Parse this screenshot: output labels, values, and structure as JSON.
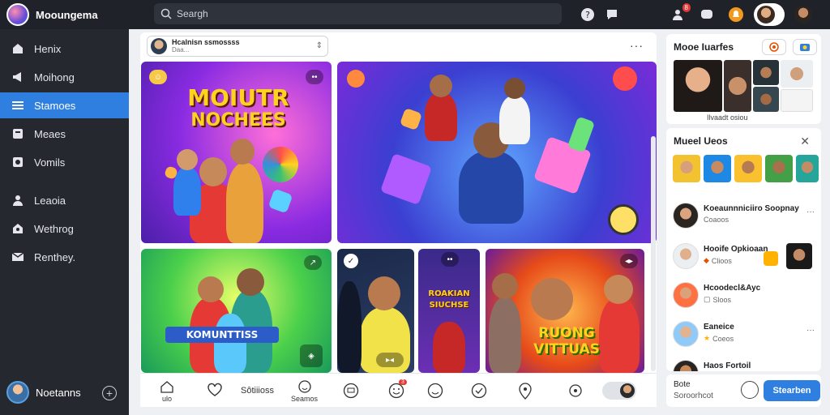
{
  "app": {
    "title": "Mooungema"
  },
  "search": {
    "placeholder": "Seargh"
  },
  "topbar": {
    "notification_count": "8"
  },
  "sidebar": {
    "items": [
      {
        "label": "Henix",
        "icon": "home-icon"
      },
      {
        "label": "Moihong",
        "icon": "megaphone-icon"
      },
      {
        "label": "Stamoes",
        "icon": "list-icon"
      },
      {
        "label": "Meaes",
        "icon": "message-icon"
      },
      {
        "label": "Vomils",
        "icon": "video-icon"
      },
      {
        "label": "Leaoia",
        "icon": "person-icon"
      },
      {
        "label": "Wethrog",
        "icon": "globe-icon"
      },
      {
        "label": "Renthey.",
        "icon": "mail-icon"
      }
    ],
    "profile_name": "Noetanns"
  },
  "composer": {
    "line1": "Hcalnisn ssmossss",
    "line2": "Daa..."
  },
  "tiles": {
    "tile1_title_a": "MOIUTR",
    "tile1_title_b": "NOCHEES",
    "tile3_caption": "KOMUNTTISS",
    "tile5_title_a": "ROAKIAN",
    "tile5_title_b": "SIUCHSE",
    "tile6_title_a": "RUONG",
    "tile6_title_b": "VITTUAS"
  },
  "bottom_bar": {
    "home_label": "ulo",
    "text_label": "Sôtiiioss",
    "stream_label": "Seamos",
    "badge_count": "3"
  },
  "right_panel": {
    "card1_title": "Mooe Iuarfes",
    "card1_caption": "Ilvaadt osiou",
    "card2_title": "Mueel Ueos",
    "rows": [
      {
        "name": "Koeaunnniciiro Soopnay",
        "sub": "Coaoos"
      },
      {
        "name": "Hooife Opkioaan",
        "sub": "Clioos"
      },
      {
        "name": "Hcoodecl&Ayc",
        "sub": "Sloos"
      },
      {
        "name": "Eaneice",
        "sub": "Coeos"
      },
      {
        "name": "Haos Fortoil",
        "sub": ""
      }
    ],
    "footer_line1": "Bote",
    "footer_line2": "Soroorhcot",
    "footer_button": "Stearben"
  },
  "colors": {
    "accent": "#2f7fe0",
    "sidebar_bg": "#25282f",
    "topbar_bg": "#1f2329"
  }
}
